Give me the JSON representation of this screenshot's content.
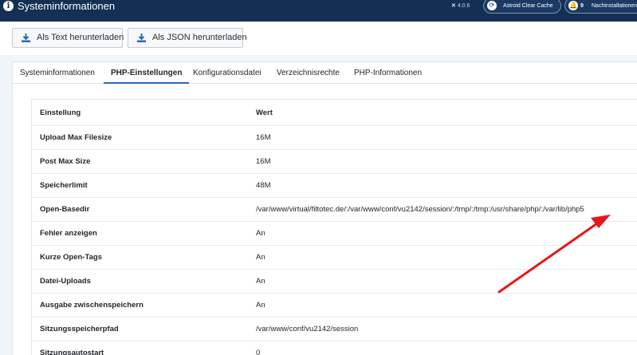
{
  "header": {
    "title": "Systeminformationen",
    "version": "4.0.6",
    "cache_label": "Astroid Clear Cache",
    "updates_count": "9",
    "updates_label": "Nachinstallationen"
  },
  "toolbar": {
    "download_text_label": "Als Text herunterladen",
    "download_json_label": "Als JSON herunterladen"
  },
  "tabs": [
    {
      "label": "Systeminformationen"
    },
    {
      "label": "PHP-Einstellungen"
    },
    {
      "label": "Konfigurationsdatei"
    },
    {
      "label": "Verzeichnisrechte"
    },
    {
      "label": "PHP-Informationen"
    }
  ],
  "table": {
    "headers": {
      "setting": "Einstellung",
      "value": "Wert"
    },
    "rows": [
      {
        "setting": "Upload Max Filesize",
        "value": "16M"
      },
      {
        "setting": "Post Max Size",
        "value": "16M"
      },
      {
        "setting": "Speicherlimit",
        "value": "48M"
      },
      {
        "setting": "Open-Basedir",
        "value": "/var/www/virtual/filtotec.de/:/var/www/conf/vu2142/session/:/tmp/:/tmp:/usr/share/php/:/var/lib/php5"
      },
      {
        "setting": "Fehler anzeigen",
        "value": "An"
      },
      {
        "setting": "Kurze Open-Tags",
        "value": "An"
      },
      {
        "setting": "Datei-Uploads",
        "value": "An"
      },
      {
        "setting": "Ausgabe zwischenspeichern",
        "value": "An"
      },
      {
        "setting": "Sitzungsspeicherpfad",
        "value": "/var/www/conf/vu2142/session"
      },
      {
        "setting": "Sitzungsautostart",
        "value": "0"
      }
    ]
  },
  "colors": {
    "header_bg": "#132f53",
    "active_tab_underline": "#2a69b8",
    "annotation_arrow": "#e8161b"
  }
}
